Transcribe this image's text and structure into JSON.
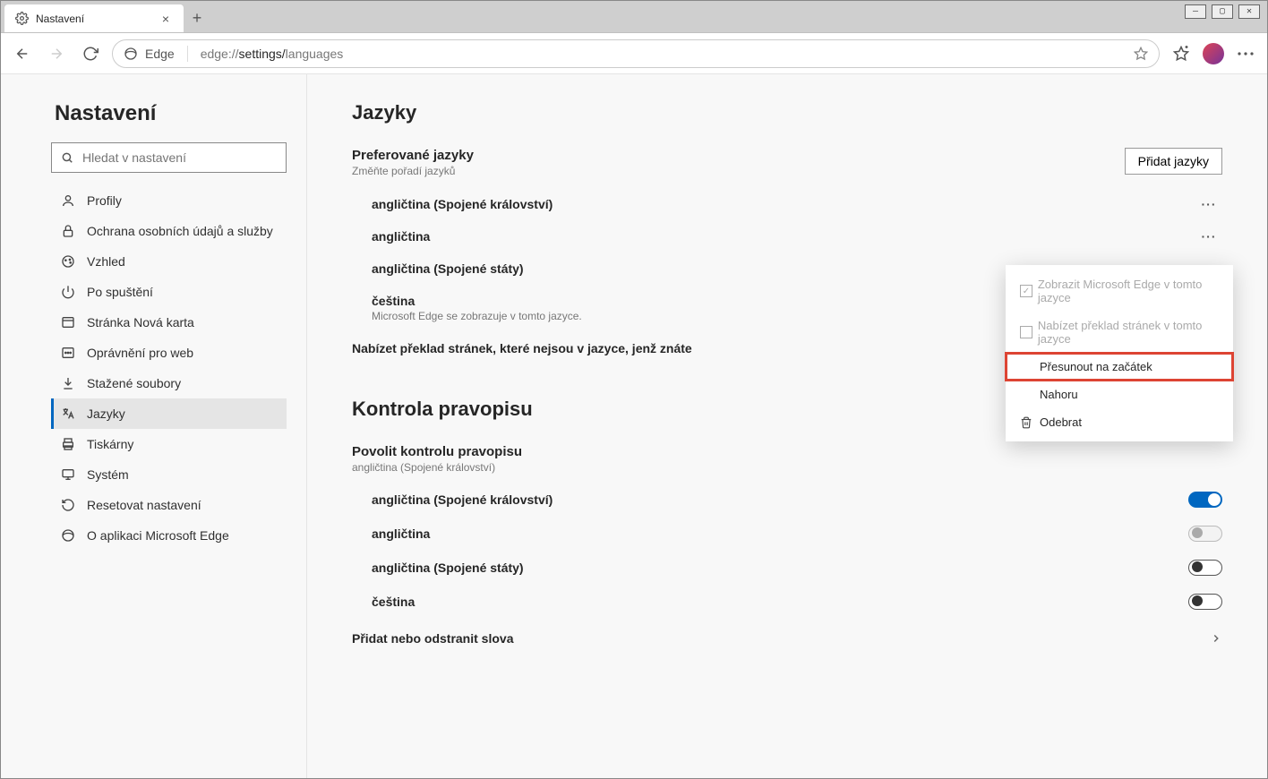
{
  "window": {
    "tab_title": "Nastavení",
    "site_name": "Edge",
    "url_prefix": "edge://",
    "url_mid": "settings/",
    "url_suffix": "languages"
  },
  "sidebar": {
    "title": "Nastavení",
    "search_placeholder": "Hledat v nastavení",
    "items": [
      {
        "label": "Profily"
      },
      {
        "label": "Ochrana osobních údajů a služby"
      },
      {
        "label": "Vzhled"
      },
      {
        "label": "Po spuštění"
      },
      {
        "label": "Stránka Nová karta"
      },
      {
        "label": "Oprávnění pro web"
      },
      {
        "label": "Stažené soubory"
      },
      {
        "label": "Jazyky"
      },
      {
        "label": "Tiskárny"
      },
      {
        "label": "Systém"
      },
      {
        "label": "Resetovat nastavení"
      },
      {
        "label": "O aplikaci Microsoft Edge"
      }
    ]
  },
  "main": {
    "languages_title": "Jazyky",
    "pref_title": "Preferované jazyky",
    "pref_note": "Změňte pořadí jazyků",
    "add_button": "Přidat jazyky",
    "languages": [
      {
        "name": "angličtina (Spojené království)",
        "note": ""
      },
      {
        "name": "angličtina",
        "note": ""
      },
      {
        "name": "angličtina (Spojené státy)",
        "note": ""
      },
      {
        "name": "čeština",
        "note": "Microsoft Edge se zobrazuje v tomto jazyce."
      }
    ],
    "offer_translate_label": "Nabízet překlad stránek, které nejsou v jazyce, jenž znáte",
    "spell_title": "Kontrola pravopisu",
    "spell_enable_label": "Povolit kontrolu pravopisu",
    "spell_enable_note": "angličtina (Spojené království)",
    "spell_langs": [
      {
        "name": "angličtina (Spojené království)",
        "state": "on"
      },
      {
        "name": "angličtina",
        "state": "off-disabled"
      },
      {
        "name": "angličtina (Spojené státy)",
        "state": "off"
      },
      {
        "name": "čeština",
        "state": "off"
      }
    ],
    "add_remove_words": "Přidat nebo odstranit slova"
  },
  "ctx_menu": {
    "display_in_lang": "Zobrazit Microsoft Edge v tomto jazyce",
    "offer_translate": "Nabízet překlad stránek v tomto jazyce",
    "move_top": "Přesunout na začátek",
    "up": "Nahoru",
    "remove": "Odebrat"
  }
}
